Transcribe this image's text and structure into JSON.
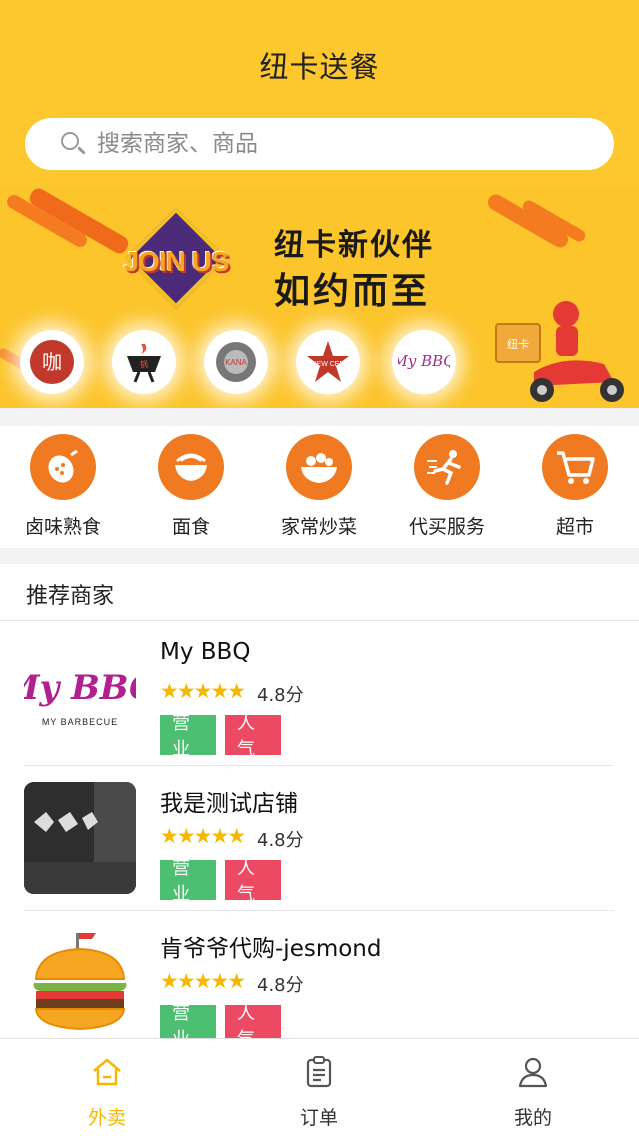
{
  "header": {
    "title": "纽卡送餐",
    "search_placeholder": "搜索商家、商品"
  },
  "banner": {
    "join_text": "JOIN US",
    "slogan_line1": "纽卡新伙伴",
    "slogan_line2": "如约而至",
    "partner_logos": [
      "咖",
      "锅",
      "KANA",
      "NEW CEN",
      "My BBQ"
    ],
    "rider_box_label": "纽卡"
  },
  "categories": [
    {
      "label": "卤味熟食",
      "icon": "sausage-icon"
    },
    {
      "label": "面食",
      "icon": "noodle-bowl-icon"
    },
    {
      "label": "家常炒菜",
      "icon": "salad-bowl-icon"
    },
    {
      "label": "代买服务",
      "icon": "runner-icon"
    },
    {
      "label": "超市",
      "icon": "shopping-cart-icon"
    }
  ],
  "recommended": {
    "title": "推荐商家",
    "stores": [
      {
        "name": "My BBQ",
        "stars": "★★★★★",
        "rating": "4.8分",
        "status": "营业",
        "tag": "人气",
        "logo_text": "My BBQ",
        "logo_sub": "MY BARBECUE"
      },
      {
        "name": "我是测试店铺",
        "stars": "★★★★★",
        "rating": "4.8分",
        "status": "营业",
        "tag": "人气",
        "logo_text": "",
        "logo_sub": ""
      },
      {
        "name": "肯爷爷代购-jesmond",
        "stars": "★★★★★",
        "rating": "4.8分",
        "status": "营业",
        "tag": "人气",
        "logo_text": "",
        "logo_sub": ""
      }
    ]
  },
  "tabbar": {
    "tabs": [
      {
        "label": "外卖",
        "icon": "home-icon",
        "active": true
      },
      {
        "label": "订单",
        "icon": "clipboard-icon",
        "active": false
      },
      {
        "label": "我的",
        "icon": "user-icon",
        "active": false
      }
    ]
  },
  "colors": {
    "brand_yellow": "#fdc72e",
    "category_orange": "#f07a22",
    "badge_green": "#4cbf72",
    "badge_red": "#ec4a63",
    "star": "#f5b800"
  }
}
